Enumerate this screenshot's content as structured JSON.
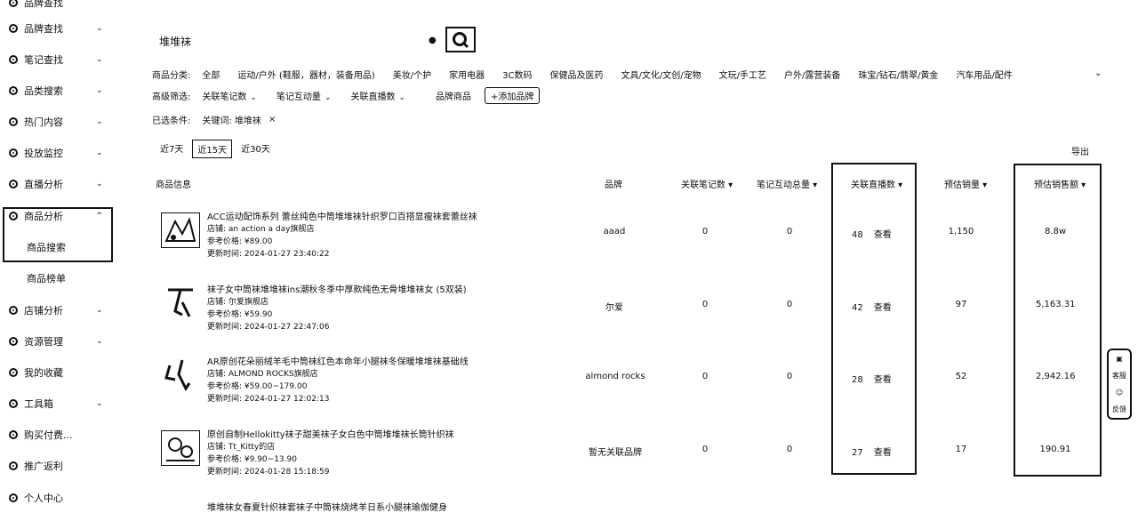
{
  "sidebar": {
    "items": [
      {
        "label": "品牌查找",
        "icon": "circle-icon",
        "chev": "⌄"
      },
      {
        "label": "笔记查找",
        "icon": "compass-icon",
        "chev": "⌄"
      },
      {
        "label": "品类搜索",
        "icon": "circle-icon",
        "chev": "⌄"
      },
      {
        "label": "热门内容",
        "icon": "circle-icon",
        "chev": "⌄"
      },
      {
        "label": "投放监控",
        "icon": "circle-icon",
        "chev": "⌄"
      },
      {
        "label": "直播分析",
        "icon": "circle-icon",
        "chev": "⌄"
      },
      {
        "label": "商品分析",
        "icon": "circle-icon",
        "chev": "^"
      },
      {
        "label": "店铺分析",
        "icon": "circle-icon",
        "chev": "⌄"
      },
      {
        "label": "资源管理",
        "icon": "circle-icon",
        "chev": "⌄"
      },
      {
        "label": "我的收藏",
        "icon": "circle-icon",
        "chev": ""
      },
      {
        "label": "工具箱",
        "icon": "circle-icon",
        "chev": "⌄"
      },
      {
        "label": "购买付费...",
        "icon": "circle-icon",
        "chev": ""
      },
      {
        "label": "推广返利",
        "icon": "circle-icon",
        "chev": ""
      },
      {
        "label": "个人中心",
        "icon": "circle-icon",
        "chev": ""
      }
    ],
    "sub_items": [
      "商品搜索",
      "商品榜单"
    ]
  },
  "search": {
    "value": "堆堆袜"
  },
  "category": {
    "label": "商品分类:",
    "options": [
      "全部",
      "运动/户外 (鞋服，器材，装备用品)",
      "美妆/个护",
      "家用电器",
      "3C数码",
      "保健品及医药",
      "文具/文化/文创/宠物",
      "文玩/手工艺",
      "户外/露营装备",
      "珠宝/钻石/翡翠/黄金",
      "汽车用品/配件"
    ]
  },
  "advanced": {
    "label": "高级筛选:",
    "filters": [
      "关联笔记数",
      "笔记互动量",
      "关联直播数"
    ],
    "brand_label": "品牌商品",
    "add_brand": "+添加品牌"
  },
  "selected": {
    "label": "已选条件:",
    "chip": "关键词: 堆堆袜",
    "chip_x": "×"
  },
  "date_ranges": [
    "近7天",
    "近15天",
    "近30天"
  ],
  "active_range": "近15天",
  "export_label": "导出",
  "table": {
    "headers": [
      "商品信息",
      "品牌",
      "关联笔记数 ▾",
      "笔记互动总量 ▾",
      "关联直播数 ▾",
      "预估销量 ▾",
      "预估销售额 ▾"
    ],
    "view_label": "查看",
    "rows": [
      {
        "title": "ACC运动配饰系列 蕾丝纯色中筒堆堆袜针织罗口百搭显瘦袜套蕾丝袜",
        "shop": "店铺: an action a day旗舰店",
        "price": "参考价格: ¥89.00",
        "updated": "更新时间: 2024-01-27 23:40:22",
        "brand": "aaad",
        "notes": "0",
        "interactions": "0",
        "lives": "48",
        "sales": "1,150",
        "revenue": "8.8w"
      },
      {
        "title": "袜子女中筒袜堆堆袜ins潮秋冬季中厚款纯色无骨堆堆袜女 (5双装)",
        "shop": "店铺: 尔爱旗舰店",
        "price": "参考价格: ¥59.90",
        "updated": "更新时间: 2024-01-27 22:47:06",
        "brand": "尔爱",
        "notes": "0",
        "interactions": "0",
        "lives": "42",
        "sales": "97",
        "revenue": "5,163.31"
      },
      {
        "title": "AR原创花朵丽绒羊毛中筒袜红色本命年小腿袜冬保暖堆堆袜基础线",
        "shop": "店铺: ALMOND ROCKS旗舰店",
        "price": "参考价格: ¥59.00~179.00",
        "updated": "更新时间: 2024-01-27 12:02:13",
        "brand": "almond rocks",
        "notes": "0",
        "interactions": "0",
        "lives": "28",
        "sales": "52",
        "revenue": "2,942.16"
      },
      {
        "title": "原创自制Hellokitty袜子甜美袜子女白色中筒堆堆袜长筒针织袜",
        "shop": "店铺: Tt_Kitty的店",
        "price": "参考价格: ¥9.90~13.90",
        "updated": "更新时间: 2024-01-28 15:18:59",
        "brand": "暂无关联品牌",
        "notes": "0",
        "interactions": "0",
        "lives": "27",
        "sales": "17",
        "revenue": "190.91"
      },
      {
        "title": "堆堆袜女春夏针织袜套袜子中筒袜烧烤羊日系小腿袜瑜伽健身"
      }
    ]
  },
  "float_bar": {
    "top_label": "客服",
    "bottom_label": "反馈"
  }
}
